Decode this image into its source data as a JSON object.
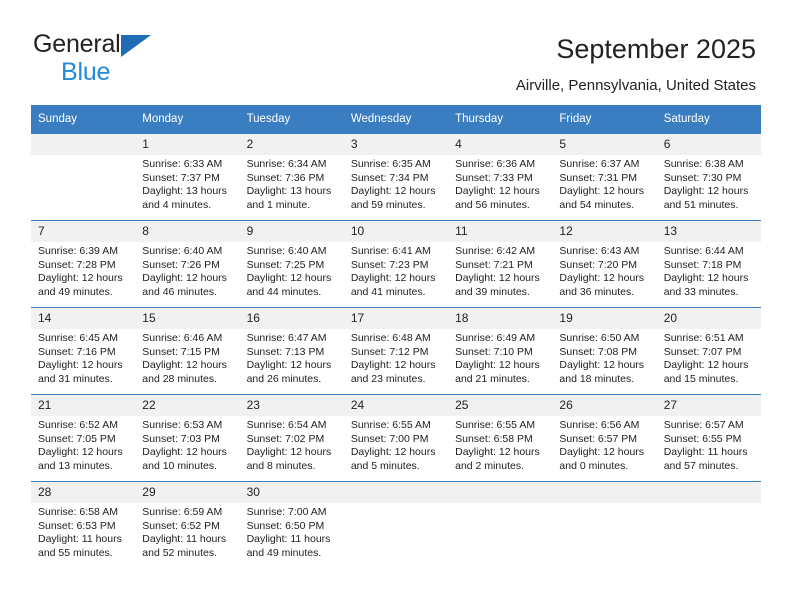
{
  "brand": {
    "name_top": "General",
    "name_bottom": "Blue",
    "accent_dark": "#1f6cb4",
    "accent_light": "#2389d8"
  },
  "header": {
    "title": "September 2025",
    "location": "Airville, Pennsylvania, United States"
  },
  "theme": {
    "header_blue": "#3a7dc0",
    "daynum_gray": "#f1f1f1",
    "text": "#222222"
  },
  "calendar": {
    "weekday_headers": [
      "Sunday",
      "Monday",
      "Tuesday",
      "Wednesday",
      "Thursday",
      "Friday",
      "Saturday"
    ],
    "labels": {
      "sunrise": "Sunrise:",
      "sunset": "Sunset:",
      "daylight": "Daylight:"
    },
    "weeks": [
      [
        {
          "day": "",
          "blank": true
        },
        {
          "day": "1",
          "sunrise": "Sunrise: 6:33 AM",
          "sunset": "Sunset: 7:37 PM",
          "daylight1": "Daylight: 13 hours",
          "daylight2": "and 4 minutes."
        },
        {
          "day": "2",
          "sunrise": "Sunrise: 6:34 AM",
          "sunset": "Sunset: 7:36 PM",
          "daylight1": "Daylight: 13 hours",
          "daylight2": "and 1 minute."
        },
        {
          "day": "3",
          "sunrise": "Sunrise: 6:35 AM",
          "sunset": "Sunset: 7:34 PM",
          "daylight1": "Daylight: 12 hours",
          "daylight2": "and 59 minutes."
        },
        {
          "day": "4",
          "sunrise": "Sunrise: 6:36 AM",
          "sunset": "Sunset: 7:33 PM",
          "daylight1": "Daylight: 12 hours",
          "daylight2": "and 56 minutes."
        },
        {
          "day": "5",
          "sunrise": "Sunrise: 6:37 AM",
          "sunset": "Sunset: 7:31 PM",
          "daylight1": "Daylight: 12 hours",
          "daylight2": "and 54 minutes."
        },
        {
          "day": "6",
          "sunrise": "Sunrise: 6:38 AM",
          "sunset": "Sunset: 7:30 PM",
          "daylight1": "Daylight: 12 hours",
          "daylight2": "and 51 minutes."
        }
      ],
      [
        {
          "day": "7",
          "sunrise": "Sunrise: 6:39 AM",
          "sunset": "Sunset: 7:28 PM",
          "daylight1": "Daylight: 12 hours",
          "daylight2": "and 49 minutes."
        },
        {
          "day": "8",
          "sunrise": "Sunrise: 6:40 AM",
          "sunset": "Sunset: 7:26 PM",
          "daylight1": "Daylight: 12 hours",
          "daylight2": "and 46 minutes."
        },
        {
          "day": "9",
          "sunrise": "Sunrise: 6:40 AM",
          "sunset": "Sunset: 7:25 PM",
          "daylight1": "Daylight: 12 hours",
          "daylight2": "and 44 minutes."
        },
        {
          "day": "10",
          "sunrise": "Sunrise: 6:41 AM",
          "sunset": "Sunset: 7:23 PM",
          "daylight1": "Daylight: 12 hours",
          "daylight2": "and 41 minutes."
        },
        {
          "day": "11",
          "sunrise": "Sunrise: 6:42 AM",
          "sunset": "Sunset: 7:21 PM",
          "daylight1": "Daylight: 12 hours",
          "daylight2": "and 39 minutes."
        },
        {
          "day": "12",
          "sunrise": "Sunrise: 6:43 AM",
          "sunset": "Sunset: 7:20 PM",
          "daylight1": "Daylight: 12 hours",
          "daylight2": "and 36 minutes."
        },
        {
          "day": "13",
          "sunrise": "Sunrise: 6:44 AM",
          "sunset": "Sunset: 7:18 PM",
          "daylight1": "Daylight: 12 hours",
          "daylight2": "and 33 minutes."
        }
      ],
      [
        {
          "day": "14",
          "sunrise": "Sunrise: 6:45 AM",
          "sunset": "Sunset: 7:16 PM",
          "daylight1": "Daylight: 12 hours",
          "daylight2": "and 31 minutes."
        },
        {
          "day": "15",
          "sunrise": "Sunrise: 6:46 AM",
          "sunset": "Sunset: 7:15 PM",
          "daylight1": "Daylight: 12 hours",
          "daylight2": "and 28 minutes."
        },
        {
          "day": "16",
          "sunrise": "Sunrise: 6:47 AM",
          "sunset": "Sunset: 7:13 PM",
          "daylight1": "Daylight: 12 hours",
          "daylight2": "and 26 minutes."
        },
        {
          "day": "17",
          "sunrise": "Sunrise: 6:48 AM",
          "sunset": "Sunset: 7:12 PM",
          "daylight1": "Daylight: 12 hours",
          "daylight2": "and 23 minutes."
        },
        {
          "day": "18",
          "sunrise": "Sunrise: 6:49 AM",
          "sunset": "Sunset: 7:10 PM",
          "daylight1": "Daylight: 12 hours",
          "daylight2": "and 21 minutes."
        },
        {
          "day": "19",
          "sunrise": "Sunrise: 6:50 AM",
          "sunset": "Sunset: 7:08 PM",
          "daylight1": "Daylight: 12 hours",
          "daylight2": "and 18 minutes."
        },
        {
          "day": "20",
          "sunrise": "Sunrise: 6:51 AM",
          "sunset": "Sunset: 7:07 PM",
          "daylight1": "Daylight: 12 hours",
          "daylight2": "and 15 minutes."
        }
      ],
      [
        {
          "day": "21",
          "sunrise": "Sunrise: 6:52 AM",
          "sunset": "Sunset: 7:05 PM",
          "daylight1": "Daylight: 12 hours",
          "daylight2": "and 13 minutes."
        },
        {
          "day": "22",
          "sunrise": "Sunrise: 6:53 AM",
          "sunset": "Sunset: 7:03 PM",
          "daylight1": "Daylight: 12 hours",
          "daylight2": "and 10 minutes."
        },
        {
          "day": "23",
          "sunrise": "Sunrise: 6:54 AM",
          "sunset": "Sunset: 7:02 PM",
          "daylight1": "Daylight: 12 hours",
          "daylight2": "and 8 minutes."
        },
        {
          "day": "24",
          "sunrise": "Sunrise: 6:55 AM",
          "sunset": "Sunset: 7:00 PM",
          "daylight1": "Daylight: 12 hours",
          "daylight2": "and 5 minutes."
        },
        {
          "day": "25",
          "sunrise": "Sunrise: 6:55 AM",
          "sunset": "Sunset: 6:58 PM",
          "daylight1": "Daylight: 12 hours",
          "daylight2": "and 2 minutes."
        },
        {
          "day": "26",
          "sunrise": "Sunrise: 6:56 AM",
          "sunset": "Sunset: 6:57 PM",
          "daylight1": "Daylight: 12 hours",
          "daylight2": "and 0 minutes."
        },
        {
          "day": "27",
          "sunrise": "Sunrise: 6:57 AM",
          "sunset": "Sunset: 6:55 PM",
          "daylight1": "Daylight: 11 hours",
          "daylight2": "and 57 minutes."
        }
      ],
      [
        {
          "day": "28",
          "sunrise": "Sunrise: 6:58 AM",
          "sunset": "Sunset: 6:53 PM",
          "daylight1": "Daylight: 11 hours",
          "daylight2": "and 55 minutes."
        },
        {
          "day": "29",
          "sunrise": "Sunrise: 6:59 AM",
          "sunset": "Sunset: 6:52 PM",
          "daylight1": "Daylight: 11 hours",
          "daylight2": "and 52 minutes."
        },
        {
          "day": "30",
          "sunrise": "Sunrise: 7:00 AM",
          "sunset": "Sunset: 6:50 PM",
          "daylight1": "Daylight: 11 hours",
          "daylight2": "and 49 minutes."
        },
        {
          "day": "",
          "blank": true
        },
        {
          "day": "",
          "blank": true
        },
        {
          "day": "",
          "blank": true
        },
        {
          "day": "",
          "blank": true
        }
      ]
    ]
  }
}
